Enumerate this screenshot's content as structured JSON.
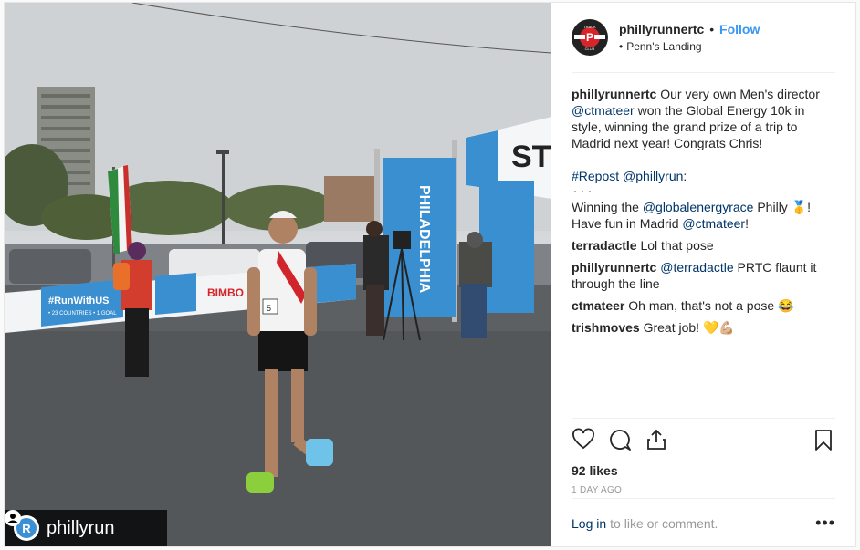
{
  "photo": {
    "repost_username": "phillyrun",
    "repost_avatar_letter": "R",
    "banner_text": "#RunWithUS",
    "banner_subtext": "• 23 COUNTRIES • 1 GOAL",
    "sponsor": "BIMBO",
    "arch_text": "ST",
    "pillar_text": "PHILADELPHIA",
    "bib_number": "5"
  },
  "header": {
    "username": "phillyrunnertc",
    "dot": "•",
    "follow_label": "Follow",
    "location": "Penn's Landing",
    "avatar_top": "TRACK",
    "avatar_letter": "P",
    "avatar_bottom": "CLUB"
  },
  "caption": {
    "username": "phillyrunnertc",
    "text_1": "Our very own Men's director",
    "mention": "@ctmateer",
    "text_2": "won the Global Energy 10k in style, winning the grand prize of a trip to Madrid next year! Congrats Chris!",
    "repost_tag": "#Repost",
    "repost_user": "@phillyrun",
    "repost_colon": ":",
    "dots": "・・・",
    "winning_1": "Winning the",
    "winning_mention": "@globalenergyrace",
    "winning_2": "Philly 🥇! Have fun in Madrid",
    "winning_mention_2": "@ctmateer",
    "winning_3": "!"
  },
  "comments": [
    {
      "user": "terradactle",
      "text": "Lol that pose",
      "mention": ""
    },
    {
      "user": "phillyrunnertc",
      "mention": "@terradactle",
      "text": "PRTC flaunt it through the line"
    },
    {
      "user": "ctmateer",
      "text": "Oh man, that's not a pose 😂",
      "mention": ""
    },
    {
      "user": "trishmoves",
      "text": "Great job! 💛💪🏼",
      "mention": ""
    }
  ],
  "actions": {
    "like_icon": "heart-icon",
    "comment_icon": "comment-icon",
    "share_icon": "share-icon",
    "save_icon": "bookmark-icon",
    "likes": "92 likes",
    "time_ago": "1 DAY AGO"
  },
  "footer": {
    "login_link": "Log in",
    "login_text": "to like or comment.",
    "more": "•••"
  },
  "colors": {
    "follow": "#3897f0",
    "link": "#003569",
    "muted": "#999999",
    "banner_blue": "#3a8fd0"
  }
}
